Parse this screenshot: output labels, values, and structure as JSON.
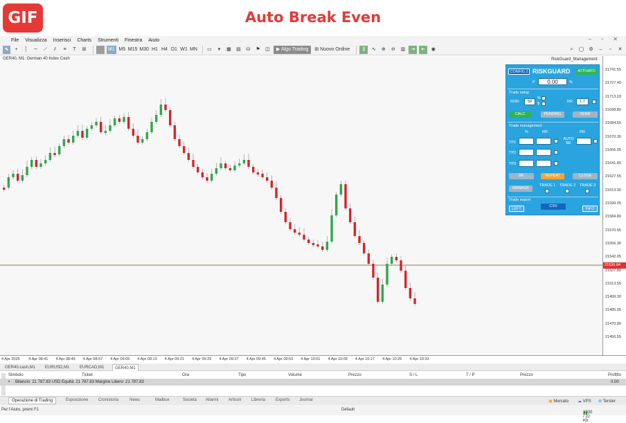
{
  "banner": {
    "gif_label": "GIF",
    "title": "Auto Break Even"
  },
  "menu": [
    "File",
    "Visualizza",
    "Inserisci",
    "Charts",
    "Strumenti",
    "Finestra",
    "Aiuto"
  ],
  "toolbar": {
    "timeframes": [
      "M1",
      "M5",
      "M15",
      "M30",
      "H1",
      "H4",
      "D1",
      "W1",
      "MN"
    ],
    "selected_timeframe": "M1",
    "algo_label": "Algo Trading",
    "new_order_label": "Nuovo Ordine"
  },
  "chart": {
    "symbol_title": "GER40, M1:  German 40 Index Cash",
    "indicator_title": "RiskGuard_Management",
    "current_price": "21536.84",
    "price_labels": [
      "21741.55",
      "21727.40",
      "21713.03",
      "21698.80",
      "21684.55",
      "21670.30",
      "21656.05",
      "21641.80",
      "21627.55",
      "21613.30",
      "21599.05",
      "21584.80",
      "21570.55",
      "21556.30",
      "21542.05",
      "21527.80",
      "21513.55",
      "21499.30",
      "21485.05",
      "21470.80",
      "21456.55"
    ],
    "time_labels": [
      "4 Apr 2025",
      "4 Apr 08:41",
      "4 Apr 08:49",
      "4 Apr 08:57",
      "4 Apr 09:05",
      "4 Apr 09:13",
      "4 Apr 09:21",
      "4 Apr 09:29",
      "4 Apr 09:37",
      "4 Apr 09:45",
      "4 Apr 09:53",
      "4 Apr 10:01",
      "4 Apr 10:09",
      "4 Apr 10:17",
      "4 Apr 10:25",
      "4 Apr 10:33"
    ],
    "colors": {
      "bull": "#2ea84a",
      "bear": "#d6242b",
      "price_line": "#c9b99a",
      "price_box": "#dd3333"
    }
  },
  "chart_tabs": [
    "GER40.cash,M1",
    "EURUSD,M1",
    "EURCAD,M1",
    "GER40,M1"
  ],
  "active_chart_tab": "GER40,M1",
  "riskguard": {
    "config_label": "CONFIG 2",
    "title": "RISKGUARD",
    "activate_label": "ATTIVATO",
    "price_label": "P",
    "price_value": "0.00",
    "price_unit": "%",
    "trade_setup_label": "Trade setup",
    "risk_label": "RISK",
    "risk_value": "50",
    "risk_unit": "%",
    "dollar_label": "$",
    "rr_label": "RR",
    "rr_value": "1.7",
    "calc_label": "CALC",
    "pending_label": "PENDING",
    "send_label": "SEND",
    "trade_management_label": "Trade management",
    "pct_header": "%",
    "rr_header": "RR",
    "auto_be_label": "AUTO BE",
    "be_header": "RR",
    "tp1_label": "TP1",
    "tp2_label": "TP2",
    "tp3_label": "TP3",
    "be_label": "BE",
    "repeat_label": "REPEAT",
    "close_label": "CLOSE",
    "manage_label": "MANAGE",
    "trade1_label": "TRADE 1",
    "trade2_label": "TRADE 2",
    "trade3_label": "TRADE 3",
    "trade_export_label": "Trade export",
    "left_label": "LEFT",
    "csv_label": "CSV",
    "info_label": "INFO"
  },
  "terminal": {
    "headers": [
      "Simbolo",
      "Ticket",
      "Ora",
      "Tipo",
      "Volume",
      "Prezzo",
      "S / L",
      "T / P",
      "Prezzo",
      "Profitto"
    ],
    "balance_text": "Bilancio: 21 787.83 USD  Equità: 21 787.83  Margine Libero: 21 787.83",
    "profit_value": "0.00",
    "tabs": [
      "Operazione di Trading",
      "Esposizione",
      "Cronistoria",
      "News",
      "Mailbox",
      "Società",
      "Allarmi",
      "Articoli",
      "Libreria",
      "Experts",
      "Journal"
    ],
    "market_label": "Mercato",
    "vps_label": "VPS",
    "tester_label": "Terster"
  },
  "status": {
    "help": "Per l'Aiuto, premi F1",
    "profile": "Default",
    "traffic": "3300 / 22 Kb"
  }
}
